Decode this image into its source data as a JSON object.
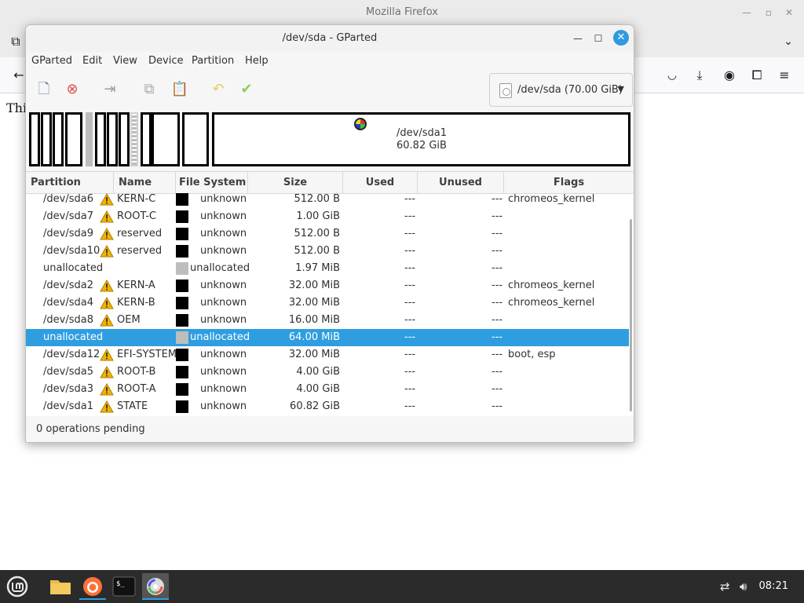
{
  "firefox": {
    "window_title": "Mozilla Firefox",
    "page_text": "Thi"
  },
  "gparted": {
    "window_title": "/dev/sda - GParted",
    "menu": [
      "GParted",
      "Edit",
      "View",
      "Device",
      "Partition",
      "Help"
    ],
    "device_selector": "/dev/sda (70.00 GiB)",
    "disk_map": {
      "big_partition_name": "/dev/sda1",
      "big_partition_size": "60.82 GiB"
    },
    "columns": [
      "Partition",
      "Name",
      "File System",
      "Size",
      "Used",
      "Unused",
      "Flags"
    ],
    "rows": [
      {
        "partition": "/dev/sda6",
        "name": "KERN-C",
        "warn": true,
        "fs": "unknown",
        "fs_color": "black",
        "size": "512.00 B",
        "used": "---",
        "unused": "---",
        "flags": "chromeos_kernel",
        "selected": false
      },
      {
        "partition": "/dev/sda7",
        "name": "ROOT-C",
        "warn": true,
        "fs": "unknown",
        "fs_color": "black",
        "size": "1.00 GiB",
        "used": "---",
        "unused": "---",
        "flags": "",
        "selected": false
      },
      {
        "partition": "/dev/sda9",
        "name": "reserved",
        "warn": true,
        "fs": "unknown",
        "fs_color": "black",
        "size": "512.00 B",
        "used": "---",
        "unused": "---",
        "flags": "",
        "selected": false
      },
      {
        "partition": "/dev/sda10",
        "name": "reserved",
        "warn": true,
        "fs": "unknown",
        "fs_color": "black",
        "size": "512.00 B",
        "used": "---",
        "unused": "---",
        "flags": "",
        "selected": false
      },
      {
        "partition": "unallocated",
        "name": "",
        "warn": false,
        "fs": "unallocated",
        "fs_color": "gray",
        "size": "1.97 MiB",
        "used": "---",
        "unused": "---",
        "flags": "",
        "selected": false
      },
      {
        "partition": "/dev/sda2",
        "name": "KERN-A",
        "warn": true,
        "fs": "unknown",
        "fs_color": "black",
        "size": "32.00 MiB",
        "used": "---",
        "unused": "---",
        "flags": "chromeos_kernel",
        "selected": false
      },
      {
        "partition": "/dev/sda4",
        "name": "KERN-B",
        "warn": true,
        "fs": "unknown",
        "fs_color": "black",
        "size": "32.00 MiB",
        "used": "---",
        "unused": "---",
        "flags": "chromeos_kernel",
        "selected": false
      },
      {
        "partition": "/dev/sda8",
        "name": "OEM",
        "warn": true,
        "fs": "unknown",
        "fs_color": "black",
        "size": "16.00 MiB",
        "used": "---",
        "unused": "---",
        "flags": "",
        "selected": false
      },
      {
        "partition": "unallocated",
        "name": "",
        "warn": false,
        "fs": "unallocated",
        "fs_color": "gray",
        "size": "64.00 MiB",
        "used": "---",
        "unused": "---",
        "flags": "",
        "selected": true
      },
      {
        "partition": "/dev/sda12",
        "name": "EFI-SYSTEM",
        "warn": true,
        "fs": "unknown",
        "fs_color": "black",
        "size": "32.00 MiB",
        "used": "---",
        "unused": "---",
        "flags": "boot, esp",
        "selected": false
      },
      {
        "partition": "/dev/sda5",
        "name": "ROOT-B",
        "warn": true,
        "fs": "unknown",
        "fs_color": "black",
        "size": "4.00 GiB",
        "used": "---",
        "unused": "---",
        "flags": "",
        "selected": false
      },
      {
        "partition": "/dev/sda3",
        "name": "ROOT-A",
        "warn": true,
        "fs": "unknown",
        "fs_color": "black",
        "size": "4.00 GiB",
        "used": "---",
        "unused": "---",
        "flags": "",
        "selected": false
      },
      {
        "partition": "/dev/sda1",
        "name": "STATE",
        "warn": true,
        "fs": "unknown",
        "fs_color": "black",
        "size": "60.82 GiB",
        "used": "---",
        "unused": "---",
        "flags": "",
        "selected": false
      }
    ],
    "status": "0 operations pending"
  },
  "taskbar": {
    "clock": "08:21",
    "accent": "#2f9ee0"
  }
}
